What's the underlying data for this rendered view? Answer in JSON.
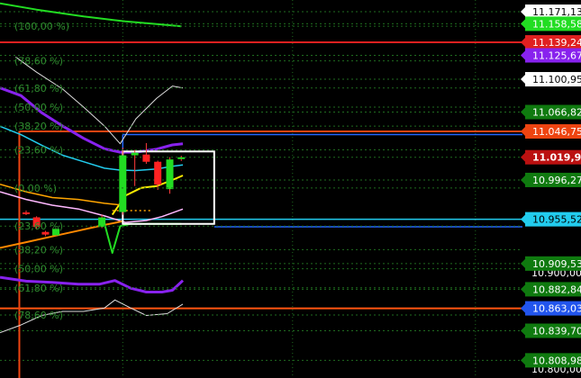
{
  "chart_data": {
    "type": "candlestick",
    "title": "",
    "xlabel": "",
    "ylabel": "",
    "y_axis_side": "right",
    "y_scale": {
      "value_a": 10.8,
      "value_b": 10.9
    },
    "colors": {
      "background": "#000000",
      "grid": "#1f6b1f",
      "fib_label": "#2e8b2e",
      "candle_up": "#22dd22",
      "candle_down": "#ff2222",
      "wick": "#ff3b3b"
    },
    "price_labels": [
      {
        "text": "11.171,13",
        "y": 11.171,
        "bg": "#ffffff",
        "fg": "#000000"
      },
      {
        "text": "11.158,58",
        "y": 11.1585,
        "bg": "#22dd22",
        "fg": "#ffffff"
      },
      {
        "text": "11.139,24",
        "y": 11.1392,
        "bg": "#e02020",
        "fg": "#ffffff"
      },
      {
        "text": "11.125,67",
        "y": 11.1257,
        "bg": "#8822ee",
        "fg": "#ffffff"
      },
      {
        "text": "11.100,95",
        "y": 11.1009,
        "bg": "#ffffff",
        "fg": "#000000"
      },
      {
        "text": "11.066,82",
        "y": 11.0668,
        "bg": "#0f7a0f",
        "fg": "#ffffff"
      },
      {
        "text": "11.046,75",
        "y": 11.0467,
        "bg": "#ee4411",
        "fg": "#ffffff"
      },
      {
        "text": "11.019,94",
        "y": 11.0199,
        "bg": "#bb1111",
        "fg": "#ffffff",
        "bold": true
      },
      {
        "text": "10.996,27",
        "y": 10.9963,
        "bg": "#0f7a0f",
        "fg": "#ffffff"
      },
      {
        "text": "10.955,52",
        "y": 10.9555,
        "bg": "#22ccee",
        "fg": "#000000"
      },
      {
        "text": "10.909,53",
        "y": 10.9095,
        "bg": "#0f7a0f",
        "fg": "#ffffff"
      },
      {
        "text": "10.882,84",
        "y": 10.8828,
        "bg": "#0f7a0f",
        "fg": "#ffffff"
      },
      {
        "text": "10.863,03",
        "y": 10.863,
        "bg": "#2255ee",
        "fg": "#ffffff"
      },
      {
        "text": "10.839,70",
        "y": 10.8397,
        "bg": "#0f7a0f",
        "fg": "#ffffff"
      },
      {
        "text": "10.808,98",
        "y": 10.809,
        "bg": "#0f7a0f",
        "fg": "#ffffff"
      }
    ],
    "axis_ticks": [
      {
        "text": "10.900,00",
        "y": 10.9
      },
      {
        "text": "10.800,00",
        "y": 10.8
      }
    ],
    "fib_levels": [
      {
        "label": "(100,00 %)",
        "y": 11.1559
      },
      {
        "label": "(78,60 %)",
        "y": 11.12
      },
      {
        "label": "(61,80 %)",
        "y": 11.0918
      },
      {
        "label": "(50,00 %)",
        "y": 11.072
      },
      {
        "label": "(38,20 %)",
        "y": 11.0522
      },
      {
        "label": "(23,60 %)",
        "y": 11.0276
      },
      {
        "label": "(0,00 %)",
        "y": 10.988
      },
      {
        "label": "(23,60 %)",
        "y": 10.9484
      },
      {
        "label": "(38,20 %)",
        "y": 10.9239
      },
      {
        "label": "(50,00 %)",
        "y": 10.9041
      },
      {
        "label": "(61,80 %)",
        "y": 10.8843
      },
      {
        "label": "(78,60 %)",
        "y": 10.8561
      }
    ],
    "horizontal_lines": [
      {
        "y": 11.1392,
        "color": "#e02020",
        "width": 2,
        "x_start": 0
      },
      {
        "y": 11.0467,
        "color": "#ee4411",
        "width": 2,
        "x_start": 0.037
      },
      {
        "y": 11.0435,
        "color": "#2266ff",
        "width": 1.5,
        "x_start": 0.235
      },
      {
        "y": 10.9555,
        "color": "#22ccee",
        "width": 1.5,
        "x_start": 0
      },
      {
        "y": 10.9477,
        "color": "#2266ff",
        "width": 1.5,
        "x_start": 0.41
      },
      {
        "y": 10.863,
        "color": "#ff5511",
        "width": 2,
        "x_start": 0
      }
    ],
    "vertical_lines": [
      {
        "x": 0.037,
        "y_top": 11.0467,
        "y_bottom": 10.79,
        "color": "#ee4411",
        "width": 2
      },
      {
        "x": 0.235,
        "y_top": 11.0435,
        "y_bottom": 10.98,
        "color": "#2266ff",
        "width": 1.5
      }
    ],
    "grid_vertical": [
      0.235,
      0.56,
      0.91
    ],
    "rectangles": [
      {
        "x0": 0.235,
        "x1": 0.41,
        "y0": 11.0259,
        "y1": 10.9507,
        "color": "#ffffff"
      }
    ],
    "candles": [
      {
        "x": 0.05,
        "open": 10.9626,
        "close": 10.9614,
        "high": 10.9646,
        "low": 10.9598
      },
      {
        "x": 0.07,
        "open": 10.9575,
        "close": 10.9475,
        "high": 10.9586,
        "low": 10.9448
      },
      {
        "x": 0.087,
        "open": 10.9423,
        "close": 10.9396,
        "high": 10.9435,
        "low": 10.938
      },
      {
        "x": 0.107,
        "open": 10.9388,
        "close": 10.9455,
        "high": 10.9463,
        "low": 10.938
      },
      {
        "x": 0.195,
        "open": 10.9475,
        "close": 10.9574,
        "high": 10.9602,
        "low": 10.9463
      },
      {
        "x": 0.235,
        "open": 10.963,
        "close": 11.0219,
        "high": 11.0299,
        "low": 10.9602
      },
      {
        "x": 0.258,
        "open": 11.0219,
        "close": 11.0247,
        "high": 11.0275,
        "low": 10.99
      },
      {
        "x": 0.28,
        "open": 11.0227,
        "close": 11.0152,
        "high": 11.0346,
        "low": 11.013
      },
      {
        "x": 0.302,
        "open": 11.0152,
        "close": 10.9915,
        "high": 11.0164,
        "low": 10.986
      },
      {
        "x": 0.325,
        "open": 10.9868,
        "close": 11.0176,
        "high": 11.02,
        "low": 10.982
      },
      {
        "x": 0.347,
        "open": 11.018,
        "close": 11.0199,
        "high": 11.0215,
        "low": 11.016
      }
    ],
    "series": [
      {
        "name": "",
        "color": "#22dd22",
        "width": 2,
        "points": [
          [
            0.0,
            11.1797
          ],
          [
            0.07,
            11.1732
          ],
          [
            0.16,
            11.1661
          ],
          [
            0.24,
            11.1609
          ],
          [
            0.3,
            11.1582
          ],
          [
            0.347,
            11.1559
          ]
        ]
      },
      {
        "name": "",
        "color": "#dddddd",
        "width": 1,
        "points": [
          [
            0.03,
            11.124
          ],
          [
            0.07,
            11.1082
          ],
          [
            0.12,
            11.0907
          ],
          [
            0.16,
            11.072
          ],
          [
            0.2,
            11.0522
          ],
          [
            0.23,
            11.0339
          ],
          [
            0.26,
            11.0597
          ],
          [
            0.3,
            11.0812
          ],
          [
            0.33,
            11.0938
          ],
          [
            0.35,
            11.0919
          ]
        ]
      },
      {
        "name": "",
        "color": "#8822ee",
        "width": 3,
        "points": [
          [
            0.0,
            11.0919
          ],
          [
            0.04,
            11.0839
          ],
          [
            0.08,
            11.0661
          ],
          [
            0.12,
            11.0522
          ],
          [
            0.16,
            11.0395
          ],
          [
            0.2,
            11.0287
          ],
          [
            0.23,
            11.0251
          ],
          [
            0.26,
            11.0251
          ],
          [
            0.3,
            11.0283
          ],
          [
            0.33,
            11.0327
          ],
          [
            0.35,
            11.0339
          ]
        ]
      },
      {
        "name": "",
        "color": "#22ccee",
        "width": 1.5,
        "points": [
          [
            0.0,
            11.0521
          ],
          [
            0.04,
            11.0434
          ],
          [
            0.08,
            11.0323
          ],
          [
            0.12,
            11.022
          ],
          [
            0.16,
            11.0152
          ],
          [
            0.2,
            11.0085
          ],
          [
            0.23,
            11.0065
          ],
          [
            0.26,
            11.0061
          ],
          [
            0.3,
            11.0077
          ],
          [
            0.33,
            11.0105
          ],
          [
            0.35,
            11.012
          ]
        ]
      },
      {
        "name": "",
        "color": "#ffee00",
        "width": 2,
        "points": [
          [
            0.215,
            10.9602
          ],
          [
            0.24,
            10.98
          ],
          [
            0.27,
            10.988
          ],
          [
            0.3,
            10.99
          ],
          [
            0.33,
            10.9963
          ],
          [
            0.35,
            11.0009
          ]
        ]
      },
      {
        "name": "",
        "color": "#ffb8ff",
        "width": 1.5,
        "points": [
          [
            0.0,
            10.984
          ],
          [
            0.05,
            10.9761
          ],
          [
            0.1,
            10.9701
          ],
          [
            0.15,
            10.9662
          ],
          [
            0.2,
            10.959
          ],
          [
            0.24,
            10.9522
          ],
          [
            0.28,
            10.9542
          ],
          [
            0.31,
            10.9582
          ],
          [
            0.35,
            10.9661
          ]
        ]
      },
      {
        "name": "",
        "color": "#ffa500",
        "width": 1.5,
        "points": [
          [
            0.0,
            10.9919
          ],
          [
            0.05,
            10.984
          ],
          [
            0.1,
            10.978
          ],
          [
            0.15,
            10.9761
          ],
          [
            0.2,
            10.9721
          ],
          [
            0.235,
            10.9701
          ]
        ]
      },
      {
        "name": "",
        "color": "#ff8800",
        "width": 2,
        "points": [
          [
            0.0,
            10.9258
          ],
          [
            0.05,
            10.9317
          ],
          [
            0.1,
            10.9377
          ],
          [
            0.15,
            10.9436
          ],
          [
            0.2,
            10.9496
          ],
          [
            0.235,
            10.9535
          ]
        ]
      },
      {
        "name": "",
        "color": "#ffa500",
        "width": 1.5,
        "dash": "2,3",
        "points": [
          [
            0.215,
            10.9645
          ],
          [
            0.29,
            10.9645
          ]
        ]
      },
      {
        "name": "",
        "color": "#22dd22",
        "width": 2,
        "points": [
          [
            0.2,
            10.951
          ],
          [
            0.215,
            10.9206
          ],
          [
            0.23,
            10.9483
          ],
          [
            0.25,
            10.9507
          ],
          [
            0.3,
            10.9507
          ],
          [
            0.347,
            10.9507
          ]
        ]
      },
      {
        "name": "",
        "color": "#8822ee",
        "width": 3,
        "points": [
          [
            0.0,
            10.8952
          ],
          [
            0.05,
            10.8912
          ],
          [
            0.1,
            10.8899
          ],
          [
            0.15,
            10.888
          ],
          [
            0.19,
            10.888
          ],
          [
            0.22,
            10.8919
          ],
          [
            0.25,
            10.8839
          ],
          [
            0.28,
            10.8799
          ],
          [
            0.31,
            10.8799
          ],
          [
            0.33,
            10.8818
          ],
          [
            0.35,
            10.8919
          ]
        ]
      },
      {
        "name": "",
        "color": "#dddddd",
        "width": 1,
        "points": [
          [
            0.0,
            10.8378
          ],
          [
            0.04,
            10.8457
          ],
          [
            0.08,
            10.8556
          ],
          [
            0.12,
            10.8598
          ],
          [
            0.16,
            10.8598
          ],
          [
            0.2,
            10.8634
          ],
          [
            0.22,
            10.8717
          ],
          [
            0.25,
            10.8634
          ],
          [
            0.28,
            10.8556
          ],
          [
            0.32,
            10.8575
          ],
          [
            0.35,
            10.8674
          ]
        ]
      }
    ]
  }
}
